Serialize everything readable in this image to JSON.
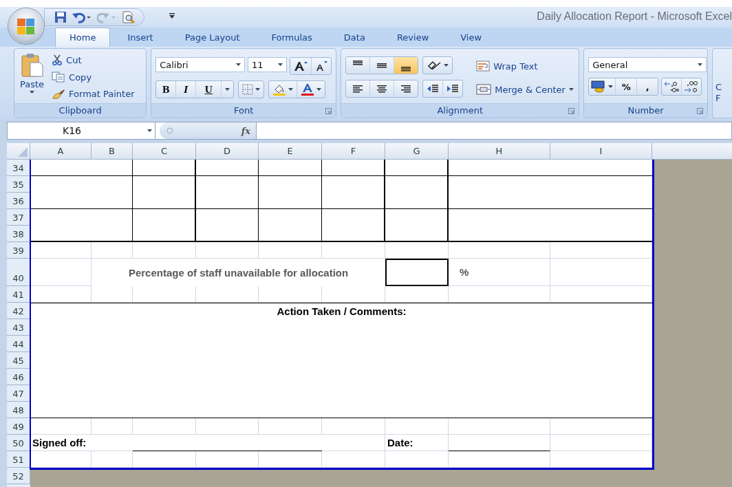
{
  "window": {
    "title": "Daily Allocation Report - Microsoft Excel"
  },
  "quick_access": [
    {
      "kind": "save",
      "disabled": false
    },
    {
      "kind": "undo",
      "disabled": false
    },
    {
      "kind": "redo",
      "disabled": true
    },
    {
      "kind": "print_preview",
      "disabled": false
    }
  ],
  "tabs": [
    {
      "label": "Home",
      "selected": true
    },
    {
      "label": "Insert",
      "selected": false
    },
    {
      "label": "Page Layout",
      "selected": false
    },
    {
      "label": "Formulas",
      "selected": false
    },
    {
      "label": "Data",
      "selected": false
    },
    {
      "label": "Review",
      "selected": false
    },
    {
      "label": "View",
      "selected": false
    }
  ],
  "clipboard": {
    "label": "Clipboard",
    "paste": "Paste",
    "cut": "Cut",
    "copy": "Copy",
    "format_painter": "Format Painter"
  },
  "font": {
    "label": "Font",
    "name": "Calibri",
    "size": "11",
    "bold": "B",
    "italic": "I",
    "underline": "U"
  },
  "alignment": {
    "label": "Alignment",
    "vertical": [
      {
        "selected": false
      },
      {
        "selected": false
      },
      {
        "selected": true
      }
    ],
    "wrap_text": "Wrap Text",
    "merge_center": "Merge & Center"
  },
  "number": {
    "label": "Number",
    "format": "General",
    "percent": "%",
    "comma": ","
  },
  "styles_partial": {
    "line_1": "C",
    "line_2": "F"
  },
  "formula_bar": {
    "name_box": "K16",
    "fx": "fx"
  },
  "sheet": {
    "columns": [
      "A",
      "B",
      "C",
      "D",
      "E",
      "F",
      "G",
      "H",
      "I"
    ],
    "rows": [
      "34",
      "35",
      "36",
      "37",
      "38",
      "39",
      "40",
      "41",
      "42",
      "43",
      "44",
      "45",
      "46",
      "47",
      "48",
      "49",
      "50",
      "51",
      "52"
    ],
    "percentage_label": "Percentage of staff unavailable for allocation",
    "percentage_unit": "%",
    "comments_heading": "Action Taken / Comments:",
    "signed_off_label": "Signed off:",
    "date_label": "Date:"
  }
}
